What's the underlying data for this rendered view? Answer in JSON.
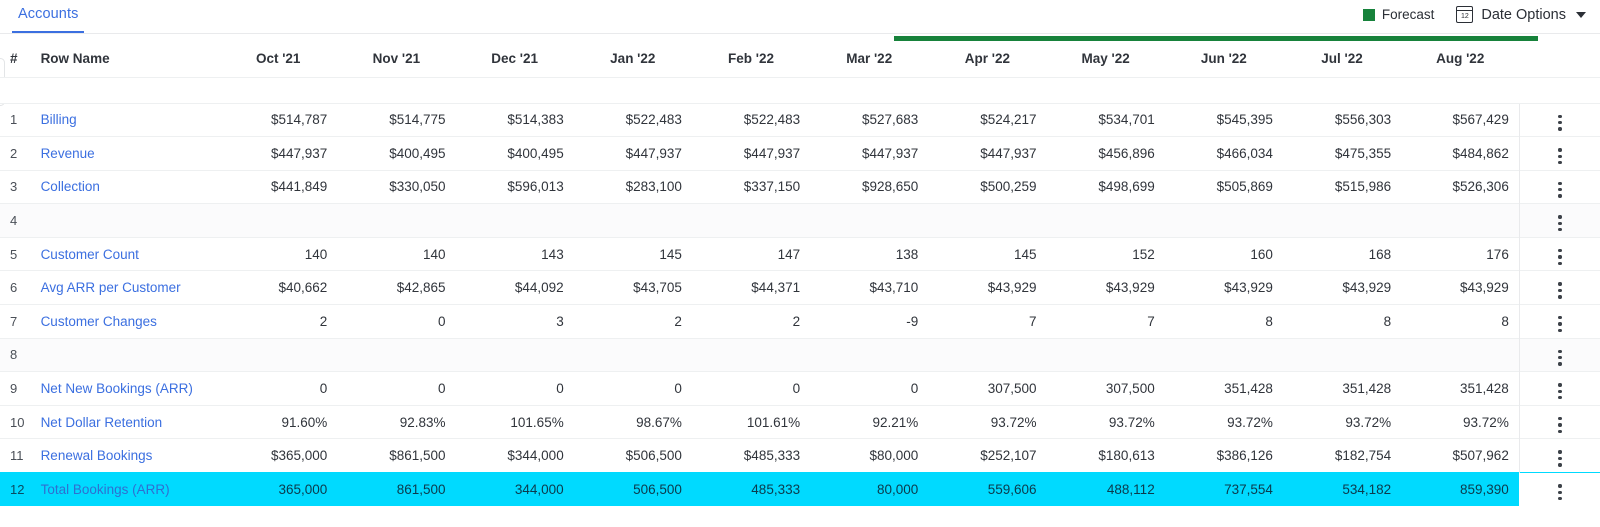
{
  "header": {
    "tabs": [
      {
        "label": "Accounts",
        "active": true
      }
    ],
    "legend": {
      "label": "Forecast",
      "color": "#17823b"
    },
    "date_options": {
      "label": "Date Options",
      "icon": "calendar-icon",
      "calendar_day": "12",
      "caret": "chevron-down-icon"
    }
  },
  "table": {
    "columns": [
      {
        "key": "num",
        "label": "#"
      },
      {
        "key": "name",
        "label": "Row Name"
      },
      {
        "key": "m0",
        "label": "Oct '21"
      },
      {
        "key": "m1",
        "label": "Nov '21"
      },
      {
        "key": "m2",
        "label": "Dec '21"
      },
      {
        "key": "m3",
        "label": "Jan '22"
      },
      {
        "key": "m4",
        "label": "Feb '22"
      },
      {
        "key": "m5",
        "label": "Mar '22"
      },
      {
        "key": "m6",
        "label": "Apr '22"
      },
      {
        "key": "m7",
        "label": "May '22"
      },
      {
        "key": "m8",
        "label": "Jun '22"
      },
      {
        "key": "m9",
        "label": "Jul '22"
      },
      {
        "key": "m10",
        "label": "Aug '22"
      }
    ],
    "forecast_start_column": "Apr '22",
    "rows": [
      {
        "num": "1",
        "name": "Billing",
        "highlight": false,
        "spacer": false,
        "values": [
          "$514,787",
          "$514,775",
          "$514,383",
          "$522,483",
          "$522,483",
          "$527,683",
          "$524,217",
          "$534,701",
          "$545,395",
          "$556,303",
          "$567,429"
        ]
      },
      {
        "num": "2",
        "name": "Revenue",
        "highlight": false,
        "spacer": false,
        "values": [
          "$447,937",
          "$400,495",
          "$400,495",
          "$447,937",
          "$447,937",
          "$447,937",
          "$447,937",
          "$456,896",
          "$466,034",
          "$475,355",
          "$484,862"
        ]
      },
      {
        "num": "3",
        "name": "Collection",
        "highlight": false,
        "spacer": false,
        "values": [
          "$441,849",
          "$330,050",
          "$596,013",
          "$283,100",
          "$337,150",
          "$928,650",
          "$500,259",
          "$498,699",
          "$505,869",
          "$515,986",
          "$526,306"
        ]
      },
      {
        "num": "4",
        "name": "",
        "highlight": false,
        "spacer": true,
        "values": [
          "",
          "",
          "",
          "",
          "",
          "",
          "",
          "",
          "",
          "",
          ""
        ]
      },
      {
        "num": "5",
        "name": "Customer Count",
        "highlight": false,
        "spacer": false,
        "values": [
          "140",
          "140",
          "143",
          "145",
          "147",
          "138",
          "145",
          "152",
          "160",
          "168",
          "176"
        ]
      },
      {
        "num": "6",
        "name": "Avg ARR per Customer",
        "highlight": false,
        "spacer": false,
        "values": [
          "$40,662",
          "$42,865",
          "$44,092",
          "$43,705",
          "$44,371",
          "$43,710",
          "$43,929",
          "$43,929",
          "$43,929",
          "$43,929",
          "$43,929"
        ]
      },
      {
        "num": "7",
        "name": "Customer Changes",
        "highlight": false,
        "spacer": false,
        "values": [
          "2",
          "0",
          "3",
          "2",
          "2",
          "-9",
          "7",
          "7",
          "8",
          "8",
          "8"
        ]
      },
      {
        "num": "8",
        "name": "",
        "highlight": false,
        "spacer": true,
        "values": [
          "",
          "",
          "",
          "",
          "",
          "",
          "",
          "",
          "",
          "",
          ""
        ]
      },
      {
        "num": "9",
        "name": "Net New Bookings (ARR)",
        "highlight": false,
        "spacer": false,
        "values": [
          "0",
          "0",
          "0",
          "0",
          "0",
          "0",
          "307,500",
          "307,500",
          "351,428",
          "351,428",
          "351,428"
        ]
      },
      {
        "num": "10",
        "name": "Net Dollar Retention",
        "highlight": false,
        "spacer": false,
        "values": [
          "91.60%",
          "92.83%",
          "101.65%",
          "98.67%",
          "101.61%",
          "92.21%",
          "93.72%",
          "93.72%",
          "93.72%",
          "93.72%",
          "93.72%"
        ]
      },
      {
        "num": "11",
        "name": "Renewal Bookings",
        "highlight": false,
        "spacer": false,
        "values": [
          "$365,000",
          "$861,500",
          "$344,000",
          "$506,500",
          "$485,333",
          "$80,000",
          "$252,107",
          "$180,613",
          "$386,126",
          "$182,754",
          "$507,962"
        ]
      },
      {
        "num": "12",
        "name": "Total Bookings (ARR)",
        "highlight": true,
        "spacer": false,
        "values": [
          "365,000",
          "861,500",
          "344,000",
          "506,500",
          "485,333",
          "80,000",
          "559,606",
          "488,112",
          "737,554",
          "534,182",
          "859,390"
        ]
      }
    ],
    "row_menu_icon": "kebab-menu-icon"
  },
  "colors": {
    "accent_blue": "#3b6fe0",
    "forecast_green": "#17823b",
    "highlight_cyan": "#00daff"
  }
}
